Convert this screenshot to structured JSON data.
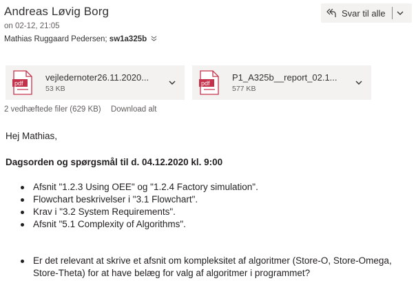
{
  "header": {
    "sender": "Andreas Løvig Borg",
    "date": "on 02-12, 21:05",
    "recipient_1": "Mathias Ruggaard Pedersen;",
    "recipient_2": "sw1a325b"
  },
  "reply_button": {
    "label": "Svar til alle",
    "icon": "reply-all-icon"
  },
  "attachments": [
    {
      "name": "vejledernoter26.11.2020...",
      "size": "53 KB",
      "icon": "pdf-icon"
    },
    {
      "name": "P1_A325b__report_02.1...",
      "size": "577 KB",
      "icon": "pdf-icon"
    }
  ],
  "attachment_summary": "2 vedhæftede filer (629 KB)",
  "download_all": "Download alt",
  "body": {
    "greeting": "Hej Mathias,",
    "agenda_title": "Dagsorden og spørgsmål til d. 04.12.2020 kl. 9:00",
    "list1": [
      "Afsnit \"1.2.3  Using OEE\" og  \"1.2.4  Factory simulation\".",
      "Flowchart beskrivelser i \"3.1  Flowchart\".",
      "Krav i \"3.2  System Requirements\".",
      "Afsnit \"5.1  Complexity of Algorithms\"."
    ],
    "list2": [
      "Er det relevant at skrive et afsnit om kompleksitet af algoritmer (Store-O, Store-Omega, Store-Theta) for at have belæg for valg af algoritmer i programmet?"
    ]
  },
  "colors": {
    "pdf_red": "#c4314b",
    "button_bg": "#f3f2f1"
  }
}
